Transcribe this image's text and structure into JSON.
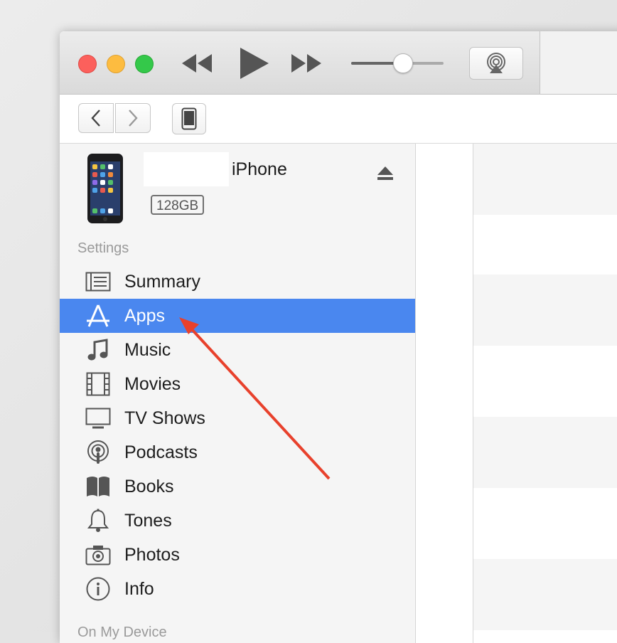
{
  "device": {
    "name": "iPhone",
    "capacity": "128GB"
  },
  "sidebar": {
    "section_label": "Settings",
    "items": [
      {
        "label": "Summary",
        "icon": "summary-icon",
        "selected": false
      },
      {
        "label": "Apps",
        "icon": "app-store-icon",
        "selected": true
      },
      {
        "label": "Music",
        "icon": "music-note-icon",
        "selected": false
      },
      {
        "label": "Movies",
        "icon": "film-icon",
        "selected": false
      },
      {
        "label": "TV Shows",
        "icon": "tv-icon",
        "selected": false
      },
      {
        "label": "Podcasts",
        "icon": "podcast-icon",
        "selected": false
      },
      {
        "label": "Books",
        "icon": "book-icon",
        "selected": false
      },
      {
        "label": "Tones",
        "icon": "bell-icon",
        "selected": false
      },
      {
        "label": "Photos",
        "icon": "camera-icon",
        "selected": false
      },
      {
        "label": "Info",
        "icon": "info-icon",
        "selected": false
      }
    ],
    "next_section_label": "On My Device"
  },
  "player": {
    "volume": 0.55
  },
  "colors": {
    "selection": "#4a87ef",
    "annotation_arrow": "#e8412c"
  }
}
